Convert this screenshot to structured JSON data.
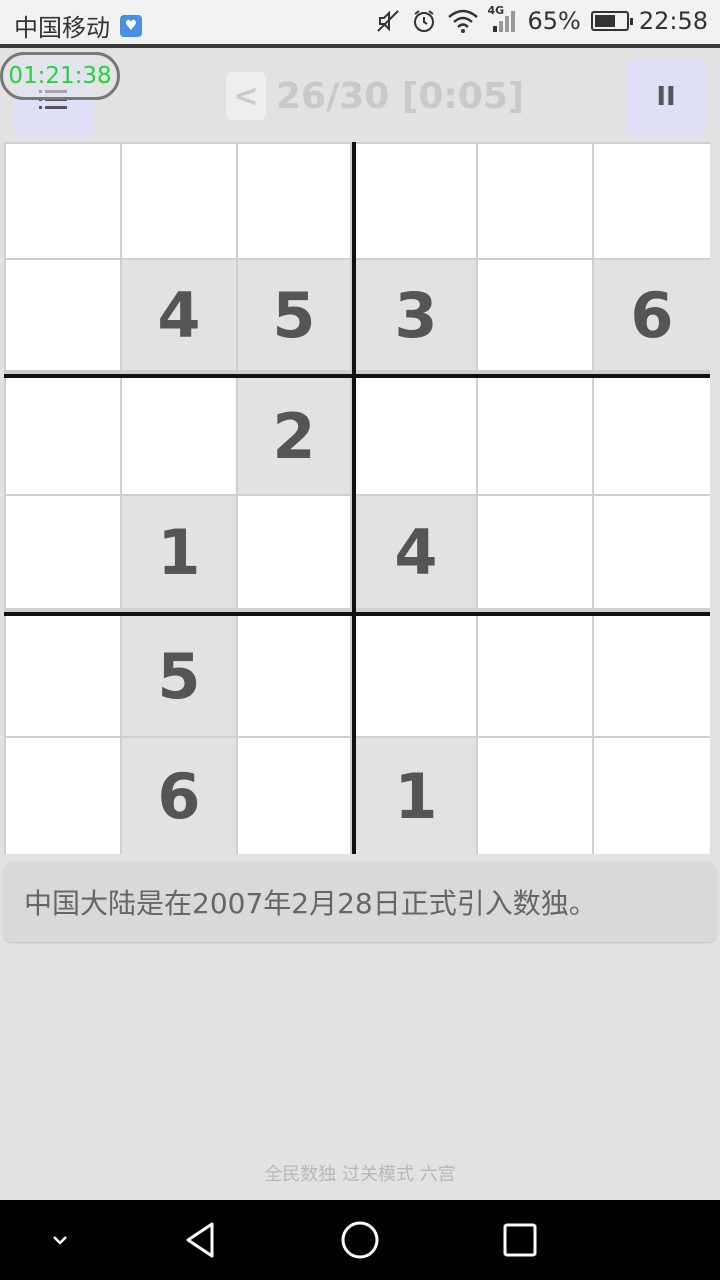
{
  "status_bar": {
    "carrier": "中国移动",
    "network": "4G",
    "battery": "65%",
    "battery_level": 0.65,
    "time": "22:58"
  },
  "toolbar": {
    "timer": "01:21:38",
    "back_label": "<",
    "progress": "26/30 [0:05]",
    "menu_icon": "hamburger-icon",
    "pause_icon": "pause-icon",
    "pause_label": "II"
  },
  "board": {
    "rows": 6,
    "cols": 6,
    "cells": [
      [
        "",
        "",
        "",
        "",
        "",
        ""
      ],
      [
        "",
        "4",
        "5",
        "3",
        "",
        "6"
      ],
      [
        "",
        "",
        "2",
        "",
        "",
        ""
      ],
      [
        "",
        "1",
        "",
        "4",
        "",
        ""
      ],
      [
        "",
        "5",
        "",
        "",
        "",
        ""
      ],
      [
        "",
        "6",
        "",
        "1",
        "",
        ""
      ]
    ]
  },
  "tip": "中国大陆是在2007年2月28日正式引入数独。",
  "footer": "全民数独 过关模式 六宫",
  "nav_bar": {
    "icons": [
      "chevron-down-icon",
      "back-triangle-icon",
      "home-circle-icon",
      "recents-square-icon"
    ]
  },
  "colors": {
    "timer": "#22d43a",
    "given_cell": "#e2e2e2",
    "button_bg": "#dfdff8"
  }
}
